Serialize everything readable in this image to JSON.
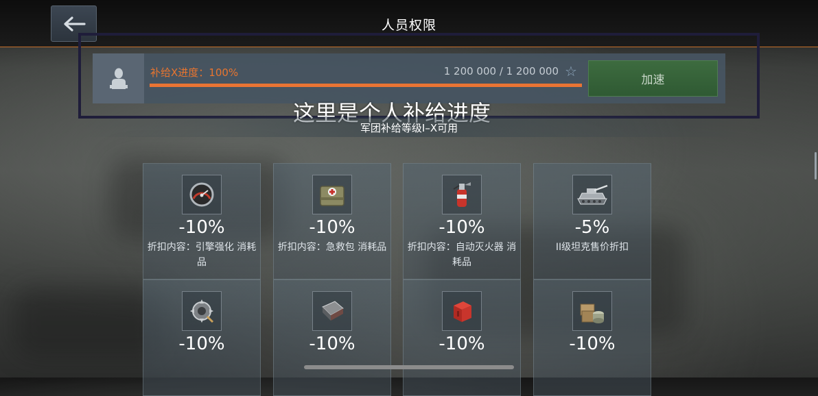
{
  "header": {
    "title": "人员权限",
    "back_icon": "arrow-left-icon"
  },
  "supply": {
    "progress_label": "补给X进度：100%",
    "progress_numbers": "1 200 000 / 1 200 000",
    "progress_fraction": 1.0,
    "star_glyph": "☆",
    "speed_button_label": "加速",
    "accent_color": "#ea7433"
  },
  "annotation_text": "这里是个人补给进度",
  "availability_text": "军团补给等级I–X可用",
  "cards": [
    {
      "icon": "engine-gauge-icon",
      "percent": "-10%",
      "description": "折扣内容：引擎强化 消耗品"
    },
    {
      "icon": "first-aid-kit-icon",
      "percent": "-10%",
      "description": "折扣内容：急救包 消耗品"
    },
    {
      "icon": "fire-extinguisher-icon",
      "percent": "-10%",
      "description": "折扣内容：自动灭火器 消耗品"
    },
    {
      "icon": "tank-icon",
      "percent": "-5%",
      "description": "II级坦克售价折扣"
    },
    {
      "icon": "gear-part-icon",
      "percent": "-10%",
      "description": ""
    },
    {
      "icon": "armor-plate-icon",
      "percent": "-10%",
      "description": ""
    },
    {
      "icon": "red-crate-icon",
      "percent": "-10%",
      "description": ""
    },
    {
      "icon": "supply-crates-icon",
      "percent": "-10%",
      "description": ""
    }
  ]
}
